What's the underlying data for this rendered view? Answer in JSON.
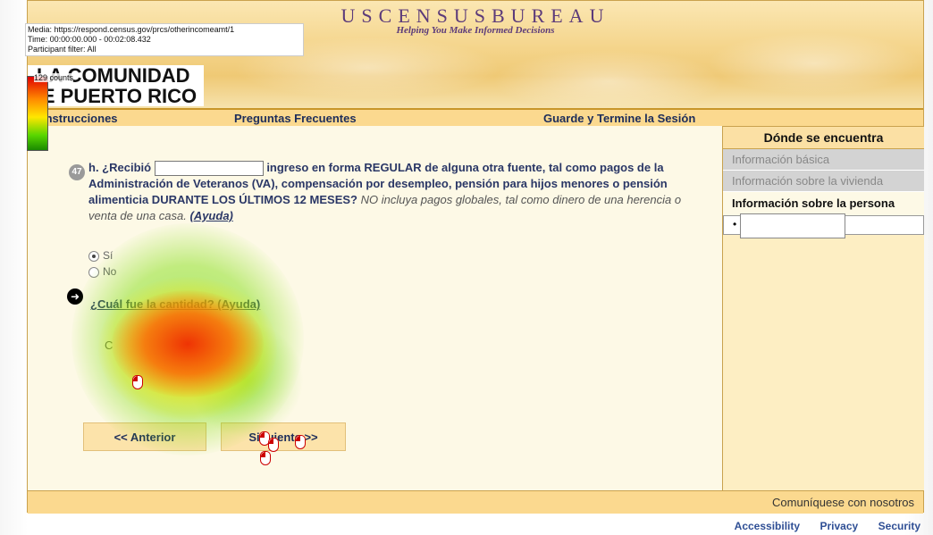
{
  "overlay": {
    "media": "Media: https://respond.census.gov/prcs/otherincomeamt/1",
    "time": "Time: 00:00:00.000 - 00:02:08.432",
    "filter": "Participant filter: All",
    "counts": "129 counts",
    "legend_colors": [
      "#e00000",
      "#ff8800",
      "#ffe600",
      "#58d600",
      "#1a8a00"
    ]
  },
  "header": {
    "title": "USCENSUSBUREAU",
    "tagline": "Helping You Make Informed Decisions",
    "brand_line1": "LA COMUNIDAD",
    "brand_line2": "DE PUERTO RICO"
  },
  "nav": {
    "instructions": "Instrucciones",
    "faq": "Preguntas Frecuentes",
    "save_exit": "Guarde y Termine la Sesión"
  },
  "sidebar": {
    "heading": "Dónde se encuentra",
    "items": [
      "Información básica",
      "Información sobre la vivienda"
    ],
    "active": "Información sobre la persona",
    "bullet": "•"
  },
  "question": {
    "number": "47",
    "prefix": "h. ¿Recibió",
    "text": "ingreso en forma REGULAR de alguna otra fuente, tal como pagos de la Administración de Veteranos (VA), compensación por desempleo, pensión para hijos menores o pensión alimenticia DURANTE LOS ÚLTIMOS 12 MESES?",
    "note": "NO incluya pagos globales, tal como dinero de una herencia o venta de una casa.",
    "help": "(Ayuda)",
    "options": [
      {
        "label": "Sí",
        "selected": true
      },
      {
        "label": "No",
        "selected": false
      }
    ],
    "followup": "¿Cuál fue la cantidad? (Ayuda)",
    "answer_prefix": "C"
  },
  "buttons": {
    "back": "<< Anterior",
    "next": "Siguiente >>"
  },
  "footer": {
    "contact": "Comuníquese con nosotros"
  },
  "links": {
    "accessibility": "Accessibility",
    "privacy": "Privacy",
    "security": "Security"
  }
}
